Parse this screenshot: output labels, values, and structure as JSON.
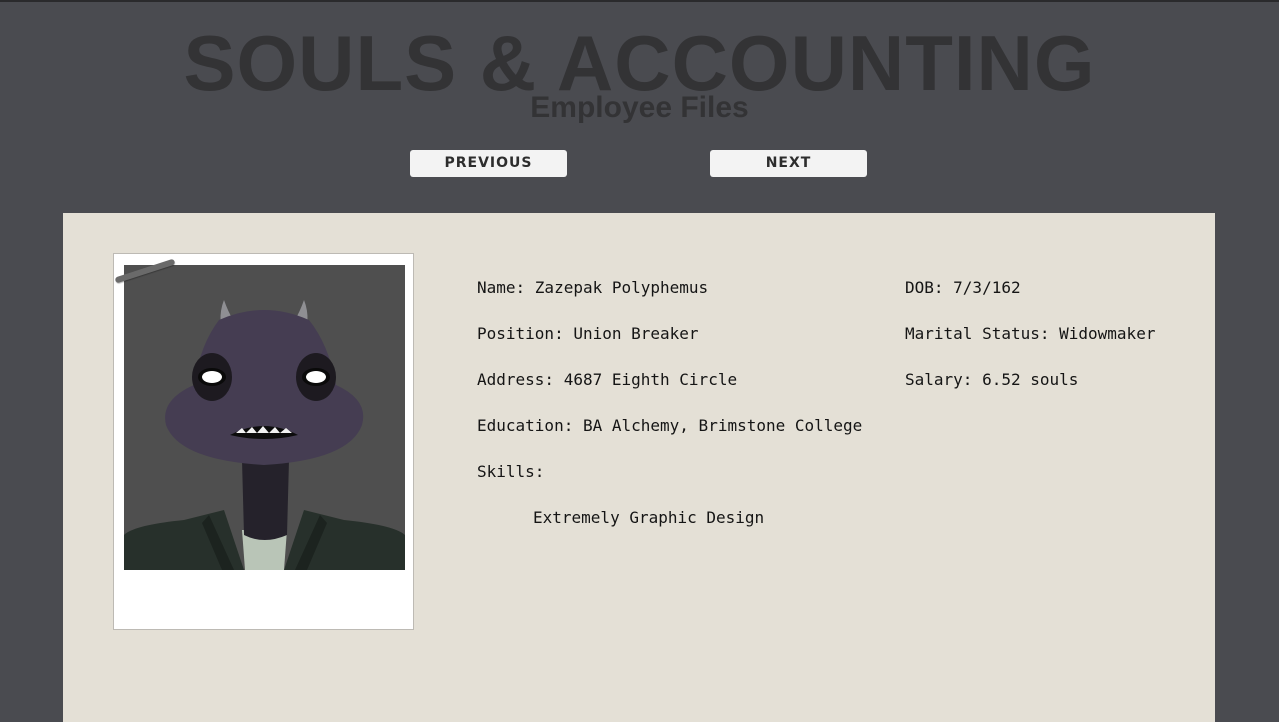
{
  "header": {
    "title": "SOULS & ACCOUNTING",
    "subtitle": "Employee Files"
  },
  "nav": {
    "previous_label": "PREVIOUS",
    "next_label": "NEXT"
  },
  "employee": {
    "name": "Name: Zazepak Polyphemus",
    "position": "Position: Union Breaker",
    "address": "Address: 4687 Eighth Circle",
    "education": "Education: BA Alchemy, Brimstone College",
    "skills_heading": "Skills:",
    "skills": [
      "Extremely Graphic Design"
    ],
    "dob": "DOB: 7/3/162",
    "marital_status": "Marital Status: Widowmaker",
    "salary": "Salary: 6.52 souls"
  },
  "colors": {
    "page_bg": "#4a4b50",
    "card_bg": "#e4e0d6",
    "title_text": "#333335",
    "button_bg": "#f3f3f3"
  }
}
